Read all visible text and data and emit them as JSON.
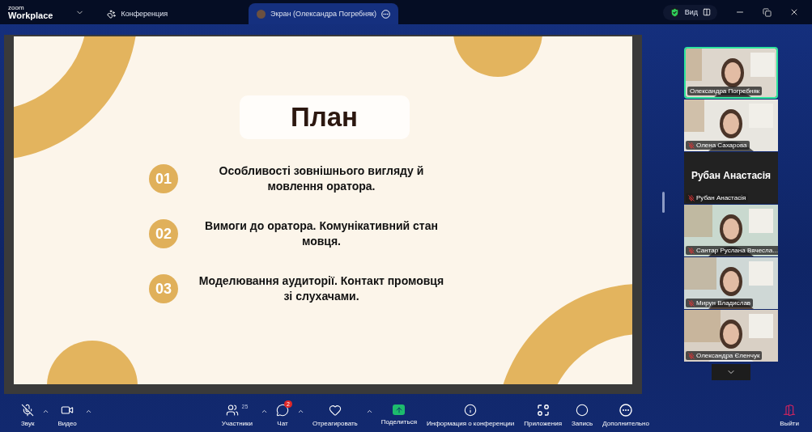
{
  "topbar": {
    "logo_small": "zoom",
    "logo": "Workplace",
    "tabs": [
      {
        "label": "Конференция",
        "kind": "meeting",
        "selected": false
      },
      {
        "label": "Экран (Олександра Погребняк)",
        "kind": "screen",
        "selected": true
      }
    ],
    "view": "Вид"
  },
  "slide": {
    "title": "План",
    "items": [
      {
        "number": "01",
        "text": "Особливості зовнішнього вигляду й мовлення оратора."
      },
      {
        "number": "02",
        "text": "Вимоги до оратора. Комунікативний стан мовця."
      },
      {
        "number": "03",
        "text": "Моделювання аудиторії. Контакт промовця зі слухачами."
      }
    ]
  },
  "participants": [
    {
      "name": "Олександра Погребняк",
      "kind": "video",
      "muted": false,
      "speaking": true
    },
    {
      "name": "Олена Сахарова",
      "kind": "video",
      "muted": true,
      "speaking": false
    },
    {
      "name": "Рубан Анастасія",
      "display_name": "Рубан Анастасія",
      "kind": "name",
      "muted": true,
      "speaking": false
    },
    {
      "name": "Сантар Руслана Вячесла...",
      "kind": "video",
      "muted": true,
      "speaking": false
    },
    {
      "name": "Мирун Владислав",
      "kind": "video",
      "muted": true,
      "speaking": false
    },
    {
      "name": "Олександра Єленчук",
      "kind": "video",
      "muted": true,
      "speaking": false
    }
  ],
  "toolbar": [
    {
      "label": "Звук",
      "kind": "audio",
      "caret": true
    },
    {
      "label": "Видео",
      "kind": "video",
      "caret": true
    },
    {
      "label": "Участники",
      "kind": "participants",
      "count": "25",
      "caret": true
    },
    {
      "label": "Чат",
      "kind": "chat",
      "badge": "2",
      "caret": true
    },
    {
      "label": "Отреагировать",
      "kind": "react",
      "caret": true
    },
    {
      "label": "Поделиться",
      "kind": "share",
      "caret": false
    },
    {
      "label": "Информация о конференции",
      "kind": "info",
      "caret": false
    },
    {
      "label": "Приложения",
      "kind": "apps",
      "caret": false
    },
    {
      "label": "Запись",
      "kind": "record",
      "caret": false
    },
    {
      "label": "Дополнительно",
      "kind": "more",
      "caret": false
    },
    {
      "label": "Выйти",
      "kind": "leave",
      "caret": false
    }
  ]
}
